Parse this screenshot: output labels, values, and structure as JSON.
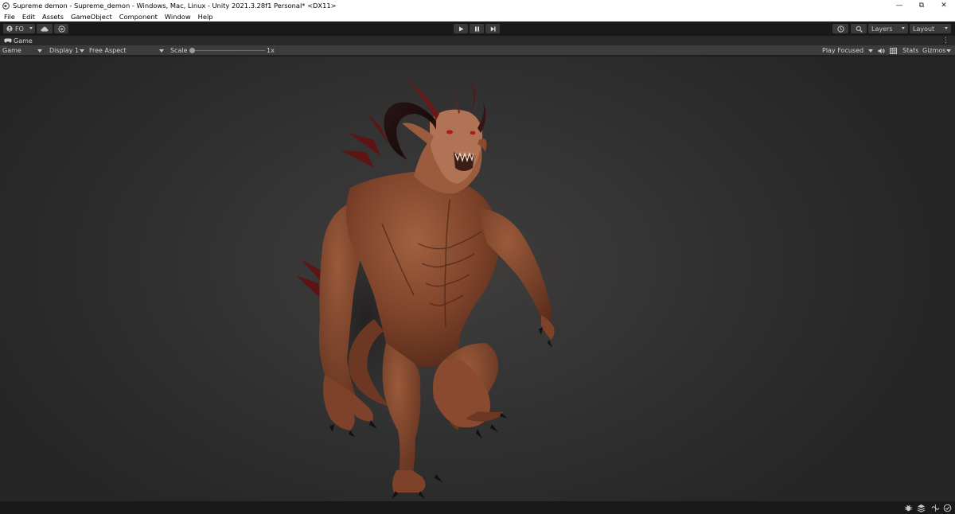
{
  "window": {
    "title": "Supreme demon - Supreme_demon - Windows, Mac, Linux - Unity 2021.3.28f1 Personal* <DX11>"
  },
  "menu": [
    "File",
    "Edit",
    "Assets",
    "GameObject",
    "Component",
    "Window",
    "Help"
  ],
  "toolbar": {
    "account_label": "FO",
    "layers_label": "Layers",
    "layout_label": "Layout"
  },
  "tab": {
    "label": "Game"
  },
  "game_toolbar": {
    "mode": "Game",
    "display": "Display 1",
    "aspect": "Free Aspect",
    "scale_label": "Scale",
    "scale_value": "1x",
    "scale_fraction": 0.0,
    "play_mode": "Play Focused",
    "stats_label": "Stats",
    "gizmos_label": "Gizmos"
  },
  "viewport": {
    "model": "demon-character-render",
    "skin_color": "#8a4a30",
    "background_color": "#333232"
  },
  "icons": [
    "unity-logo-icon",
    "minimize-icon",
    "maximize-icon",
    "close-icon",
    "cloud-icon",
    "collab-icon",
    "play-icon",
    "pause-icon",
    "step-icon",
    "history-icon",
    "search-icon",
    "audio-icon",
    "grid-icon",
    "bug-icon",
    "layers-icon",
    "check-icon"
  ]
}
